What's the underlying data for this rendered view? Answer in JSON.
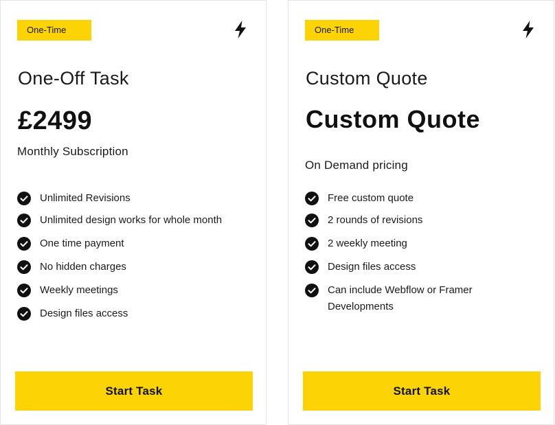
{
  "cards": [
    {
      "badge": "One-Time",
      "icon": "lightning-bolt-icon",
      "title": "One-Off Task",
      "price": "£2499",
      "subtitle": "Monthly Subscription",
      "features": [
        "Unlimited Revisions",
        "Unlimited design works for whole month",
        "One time payment",
        "No hidden charges",
        "Weekly meetings",
        "Design files access"
      ],
      "cta": "Start Task"
    },
    {
      "badge": "One-Time",
      "icon": "lightning-bolt-icon",
      "title": "Custom Quote",
      "price": "Custom Quote",
      "subtitle": "On Demand pricing",
      "features": [
        "Free custom quote",
        "2 rounds of revisions",
        "2 weekly meeting",
        "Design files access",
        "Can include Webflow or Framer Developments"
      ],
      "cta": "Start Task"
    }
  ],
  "colors": {
    "accent": "#fcd304",
    "text": "#141414",
    "border": "#e3e3e3"
  }
}
